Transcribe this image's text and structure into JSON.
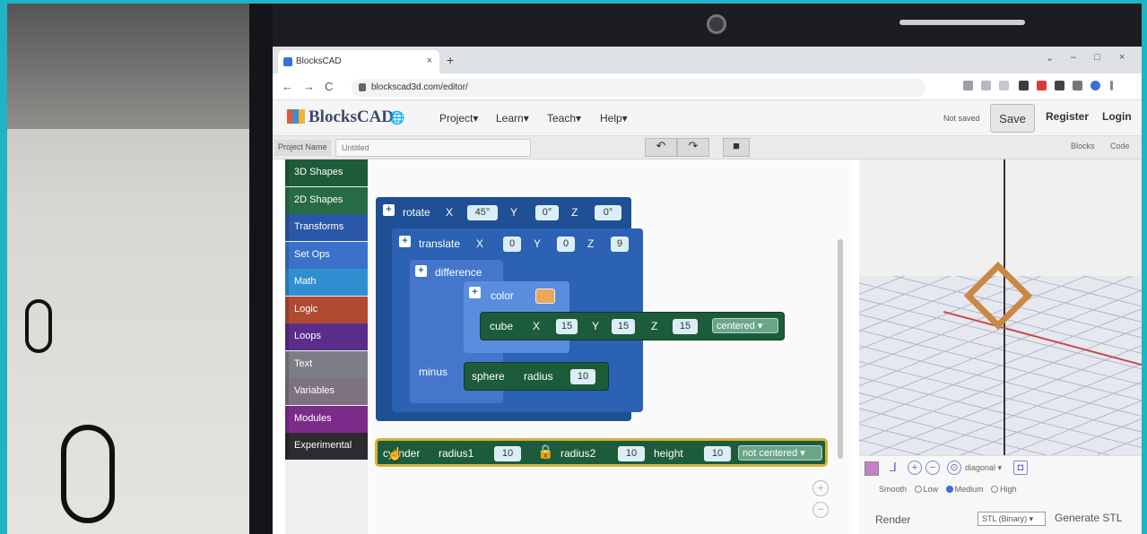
{
  "browser": {
    "tab_title": "BlocksCAD",
    "tab_close": "×",
    "new_tab": "+",
    "url": "blockscad3d.com/editor/",
    "window_controls": [
      "⌄",
      "–",
      "□",
      "×"
    ]
  },
  "header": {
    "logo_text": "BlocksCAD",
    "globe_icon": "🌐",
    "menus": [
      "Project",
      "Learn",
      "Teach",
      "Help"
    ],
    "status": "Not saved",
    "save_label": "Save",
    "register_label": "Register",
    "login_label": "Login"
  },
  "project_bar": {
    "name_label": "Project Name",
    "name_value": "Untitled",
    "undo_icon": "undo-icon",
    "redo_icon": "redo-icon",
    "trash_icon": "trash-icon",
    "view_tabs": [
      "Blocks",
      "Code"
    ]
  },
  "categories": [
    {
      "label": "3D Shapes",
      "color": "#1e5b39"
    },
    {
      "label": "2D Shapes",
      "color": "#276b44"
    },
    {
      "label": "Transforms",
      "color": "#2a57a8"
    },
    {
      "label": "Set Ops",
      "color": "#3a72c9"
    },
    {
      "label": "Math",
      "color": "#2f8fd0"
    },
    {
      "label": "Logic",
      "color": "#b04a30"
    },
    {
      "label": "Loops",
      "color": "#5a2d8a"
    },
    {
      "label": "Text",
      "color": "#7d7d86"
    },
    {
      "label": "Variables",
      "color": "#7e7282"
    },
    {
      "label": "Modules",
      "color": "#7b2c8b"
    },
    {
      "label": "Experimental",
      "color": "#2b2b30"
    }
  ],
  "blocks": {
    "rotate": {
      "label": "rotate",
      "x_label": "X",
      "x": "45°",
      "y_label": "Y",
      "y": "0°",
      "z_label": "Z",
      "z": "0°"
    },
    "translate": {
      "label": "translate",
      "x_label": "X",
      "x": "0",
      "y_label": "Y",
      "y": "0",
      "z_label": "Z",
      "z": "9"
    },
    "difference": {
      "label": "difference",
      "minus_label": "minus"
    },
    "color": {
      "label": "color",
      "value": "#e9a85a"
    },
    "cube": {
      "label": "cube",
      "x_label": "X",
      "x": "15",
      "y_label": "Y",
      "y": "15",
      "z_label": "Z",
      "z": "15",
      "mode": "centered ▾"
    },
    "sphere": {
      "label": "sphere",
      "radius_label": "radius",
      "radius": "10"
    },
    "cylinder": {
      "label": "cylinder",
      "r1_label": "radius1",
      "r1": "10",
      "r2_label": "radius2",
      "r2": "10",
      "height_label": "height",
      "height": "10",
      "mode": "not centered ▾"
    }
  },
  "render": {
    "view_option": "diagonal ▾",
    "smooth_label": "Smooth",
    "smooth_options": [
      "Low",
      "Medium",
      "High"
    ],
    "smooth_selected": "Medium",
    "render_label": "Render",
    "format": "STL (Binary) ▾",
    "generate_label": "Generate STL",
    "shape_color": "#c98844"
  }
}
